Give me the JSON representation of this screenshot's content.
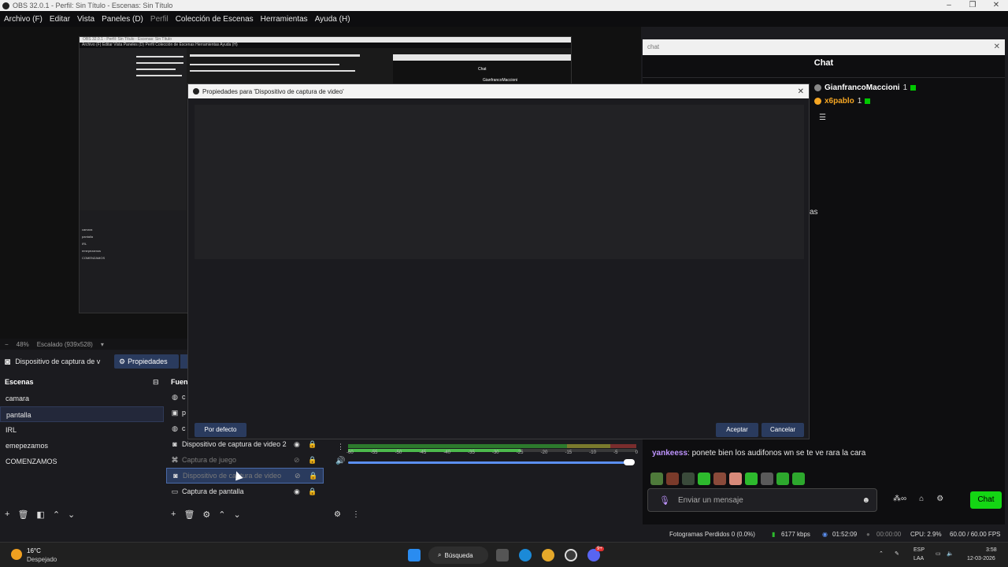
{
  "window": {
    "title": "OBS 32.0.1 - Perfil: Sin Título - Escenas: Sin Título",
    "controls": [
      "–",
      "❐",
      "✕"
    ]
  },
  "menu": [
    "Archivo (F)",
    "Editar",
    "Vista",
    "Paneles (D)",
    "Perfil",
    "Colección de Escenas",
    "Herramientas",
    "Ayuda (H)"
  ],
  "nested_preview": {
    "title": "OBS 32.0.1 - Perfil: Sin Título - Escenas: Sin Título",
    "menu": "Archivo (F)   Editar   Vista   Paneles (D)   Perfil   Colección de Escenas   Herramientas   Ayuda (H)",
    "chat_title": "Chat",
    "chat_user": "GianfrancoMaccioni",
    "scenes": [
      "camara",
      "pantalla",
      "IRL",
      "emepezamos",
      "COMENZAMOS"
    ]
  },
  "preview_bar": {
    "zoom": "48%",
    "scaling": "Escalado (939x528)"
  },
  "source_toolbar": {
    "source_label": "Dispositivo de captura de v",
    "properties_label": "Propiedades"
  },
  "scenes": {
    "header": "Escenas",
    "items": [
      "camara",
      "pantalla",
      "IRL",
      "emepezamos",
      "COMENZAMOS"
    ],
    "active_index": 1
  },
  "sources": {
    "header": "Fuente",
    "items": [
      {
        "name": "c",
        "icon": "globe-icon"
      },
      {
        "name": "p",
        "icon": "image-icon"
      },
      {
        "name": "c",
        "icon": "globe-icon"
      },
      {
        "name": "Dispositivo de captura de video 2",
        "icon": "camera-icon"
      },
      {
        "name": "Captura de juego",
        "icon": "gamepad-icon"
      },
      {
        "name": "Dispositivo de captura de video",
        "icon": "camera-icon"
      },
      {
        "name": "Captura de pantalla",
        "icon": "monitor-icon"
      }
    ]
  },
  "mixer": {
    "scale": [
      "-60",
      "-55",
      "-50",
      "-45",
      "-40",
      "-35",
      "-30",
      "-25",
      "-20",
      "-15",
      "-10",
      "-5",
      "0"
    ]
  },
  "dialog": {
    "title": "Propiedades para 'Dispositivo de captura de video'",
    "defaults_button": "Por defecto",
    "ok_button": "Aceptar",
    "cancel_button": "Cancelar"
  },
  "chat": {
    "dock_title": "chat",
    "title": "Chat",
    "users": [
      {
        "name": "GianfrancoMaccioni",
        "count": "1",
        "color": "#ffffff"
      },
      {
        "name": "x6pablo",
        "count": "1",
        "color": "#f5a623"
      }
    ],
    "partial_text": "as",
    "message_user": "yankeess",
    "message_text": "ponete bien los audifonos wn se te ve rara la cara",
    "input_placeholder": "Enviar un mensaje",
    "send_label": "Chat",
    "accent": "#14d614"
  },
  "status": {
    "dropped_frames": "Fotogramas Perdidos 0 (0.0%)",
    "bitrate": "6177 kbps",
    "stream_time": "01:52:09",
    "rec_time": "00:00:00",
    "cpu": "CPU: 2.9%",
    "fps": "60.00 / 60.00 FPS"
  },
  "taskbar": {
    "temperature": "16°C",
    "condition": "Despejado",
    "search": "Búsqueda",
    "language": "ESP",
    "language_region": "LAA",
    "time": "3:58",
    "date": "12-03-2026",
    "discord_badge": "9+"
  }
}
